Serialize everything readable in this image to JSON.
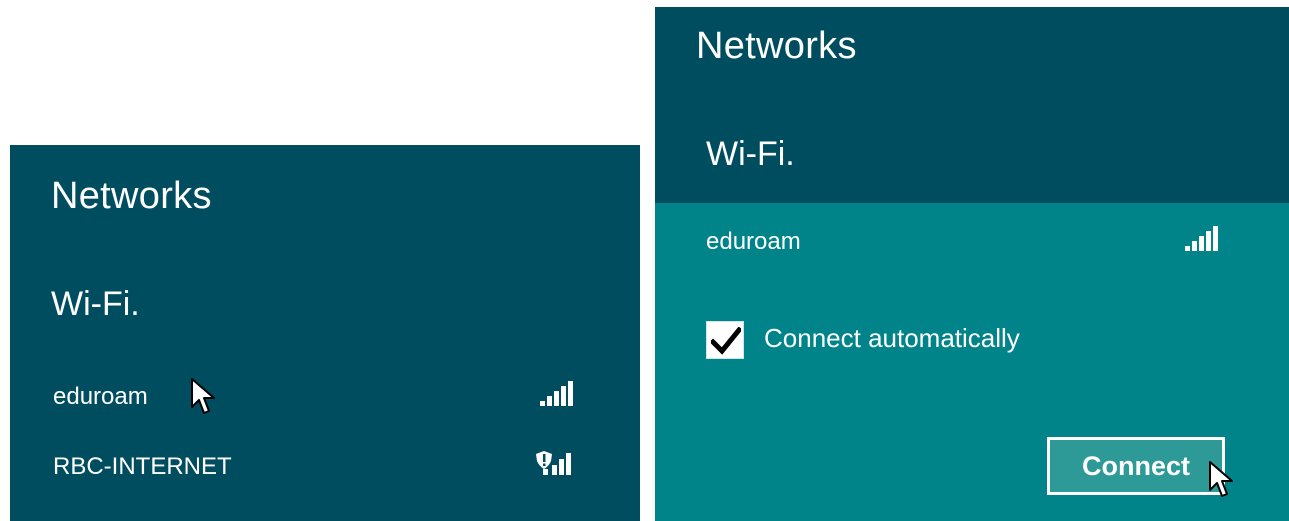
{
  "left_panel": {
    "title": "Networks",
    "section": "Wi-Fi.",
    "networks": [
      {
        "name": "eduroam",
        "signal_icon": "wifi-signal-icon"
      },
      {
        "name": "RBC-INTERNET",
        "signal_icon": "wifi-signal-secured-warning-icon"
      }
    ]
  },
  "right_panel": {
    "title": "Networks",
    "section": "Wi-Fi.",
    "selected_network": {
      "name": "eduroam",
      "signal_icon": "wifi-signal-icon",
      "connect_automatically_label": "Connect automatically",
      "connect_automatically_checked": true,
      "connect_button_label": "Connect"
    }
  },
  "colors": {
    "panel_background": "#004d5f",
    "selected_background": "#008489",
    "button_background": "#2d9a97",
    "text": "#ffffff"
  }
}
